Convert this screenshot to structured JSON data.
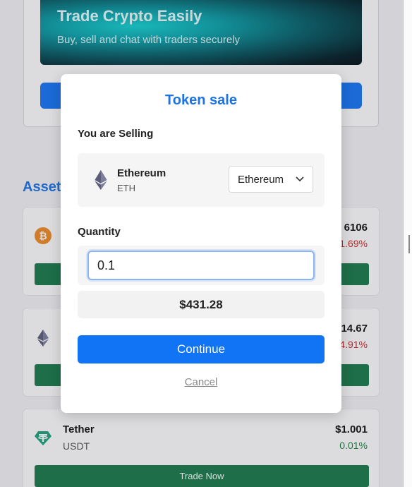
{
  "hero": {
    "title": "Trade Crypto Easily",
    "subtitle": "Buy, sell and chat with traders securely",
    "colors": {
      "button": "#1474f7"
    }
  },
  "assets": {
    "title": "Assets",
    "items": [
      {
        "name": "",
        "symbol": "",
        "price": "6106",
        "change": "1.69%",
        "change_dir": "neg",
        "icon": "bitcoin-icon",
        "trade_label": ""
      },
      {
        "name": "",
        "symbol": "",
        "price": "14.67",
        "change": "4.91%",
        "change_dir": "neg",
        "icon": "ethereum-icon",
        "trade_label": ""
      },
      {
        "name": "Tether",
        "symbol": "USDT",
        "price": "$1.001",
        "change": "0.01%",
        "change_dir": "pos",
        "icon": "tether-icon",
        "trade_label": "Trade Now"
      }
    ]
  },
  "modal": {
    "title": "Token sale",
    "selling_label": "You are Selling",
    "token": {
      "name": "Ethereum",
      "symbol": "ETH",
      "icon": "ethereum-icon"
    },
    "select": {
      "selected": "Ethereum"
    },
    "quantity_label": "Quantity",
    "quantity_value": "0.1",
    "usd_value": "$431.28",
    "continue_label": "Continue",
    "cancel_label": "Cancel"
  },
  "colors": {
    "accent": "#1a73e8",
    "primary_button": "#1174f5",
    "trade_button": "#18794a",
    "negative": "#c62828",
    "positive": "#1a7f3c"
  }
}
